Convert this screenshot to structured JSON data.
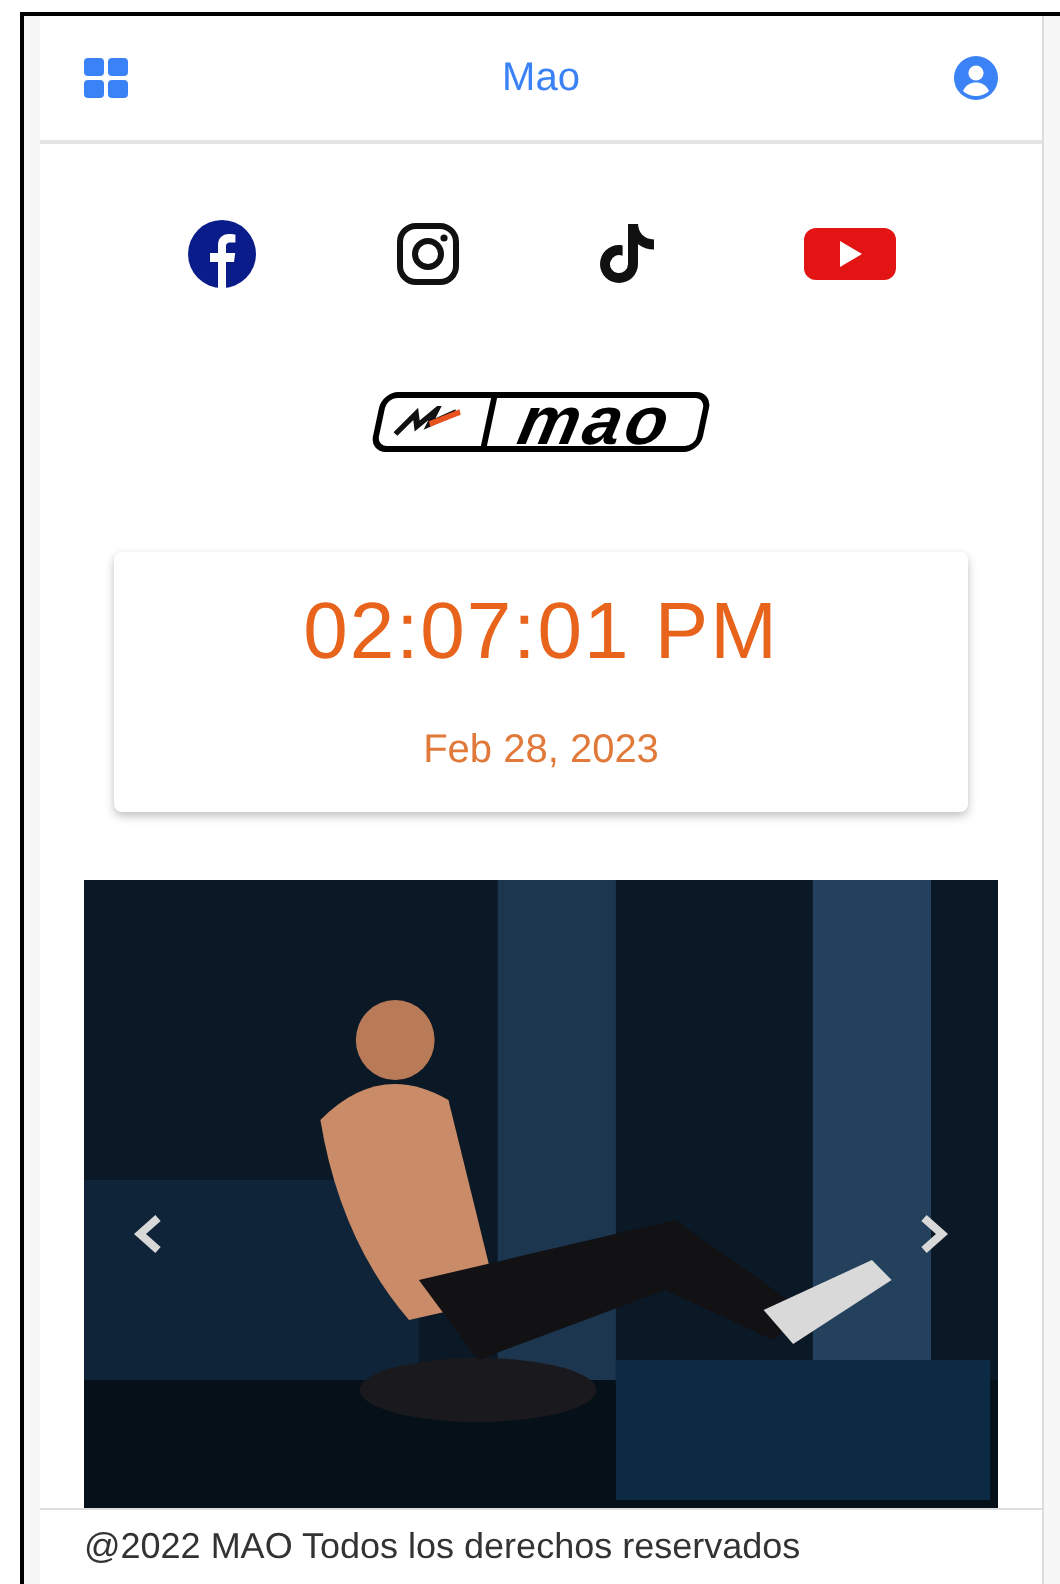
{
  "app_bar": {
    "title": "Mao"
  },
  "social_links": [
    {
      "kind": "facebook"
    },
    {
      "kind": "instagram"
    },
    {
      "kind": "tiktok"
    },
    {
      "kind": "youtube"
    }
  ],
  "logo": {
    "text": "mao"
  },
  "clock": {
    "time": "02:07:01 PM",
    "date": "Feb 28, 2023"
  },
  "footer": {
    "text": "@2022 MAO Todos los derechos reservados"
  }
}
